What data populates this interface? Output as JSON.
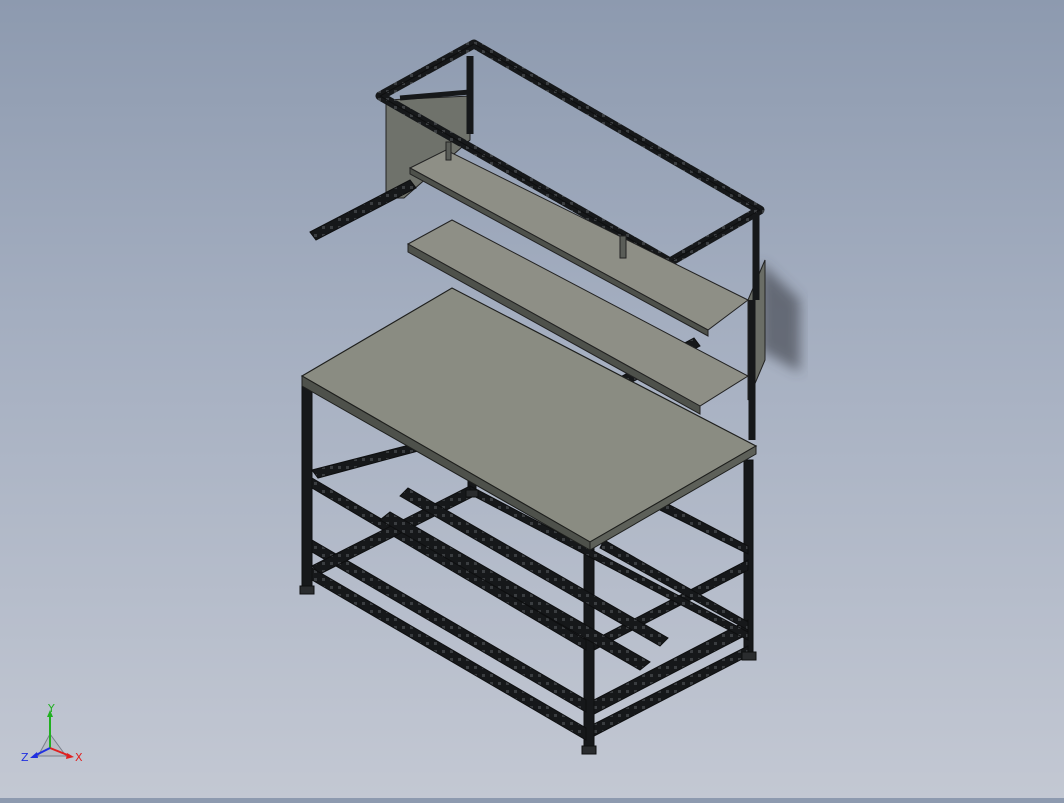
{
  "viewport": {
    "background_top": "#8d9aaf",
    "background_bottom": "#c3c8d3",
    "model": "workbench-with-upper-shelves"
  },
  "colors": {
    "profile": "#16181a",
    "profile_slot": "#3a3d40",
    "panel_top": "#8a8c82",
    "panel_edge": "#4e514b",
    "shelf_top": "#8e8f86",
    "back_panel": "#6f726b"
  },
  "triad": {
    "x_label": "X",
    "y_label": "Y",
    "z_label": "Z",
    "x_color": "#e02020",
    "y_color": "#20b020",
    "z_color": "#2030e0"
  }
}
